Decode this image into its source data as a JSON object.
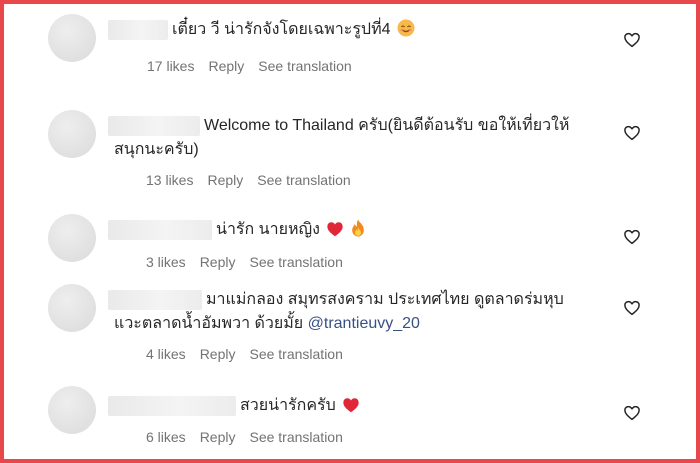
{
  "comments": [
    {
      "text": "เตี๋ยว วี น่ารักจังโดยเฉพาะรูปที่4",
      "emoji": "smiling-face-icon",
      "likes": "17 likes",
      "reply": "Reply",
      "translate": "See translation"
    },
    {
      "text": "Welcome to Thailand ครับ(ยินดีต้อนรับ ขอให้เที่ยวให้",
      "text_line2": "สนุกนะครับ)",
      "likes": "13 likes",
      "reply": "Reply",
      "translate": "See translation"
    },
    {
      "text": "น่ารัก นายหญิง",
      "emoji": "red-heart-icon",
      "emoji2": "fire-icon",
      "likes": "3 likes",
      "reply": "Reply",
      "translate": "See translation"
    },
    {
      "text": "มาแม่กลอง สมุทรสงคราม ประเทศไทย ดูตลาดร่มหุบ",
      "text_line2": "แวะตลาดน้ำอัมพวา ด้วยมั้ย",
      "mention": "@trantieuvy_20",
      "likes": "4 likes",
      "reply": "Reply",
      "translate": "See translation"
    },
    {
      "text": "สวยน่ารักครับ",
      "emoji": "red-heart-icon",
      "likes": "6 likes",
      "reply": "Reply",
      "translate": "See translation"
    }
  ],
  "colors": {
    "frame_border": "#e8474b",
    "text": "#262626",
    "meta": "#737373",
    "mention": "#385185"
  }
}
